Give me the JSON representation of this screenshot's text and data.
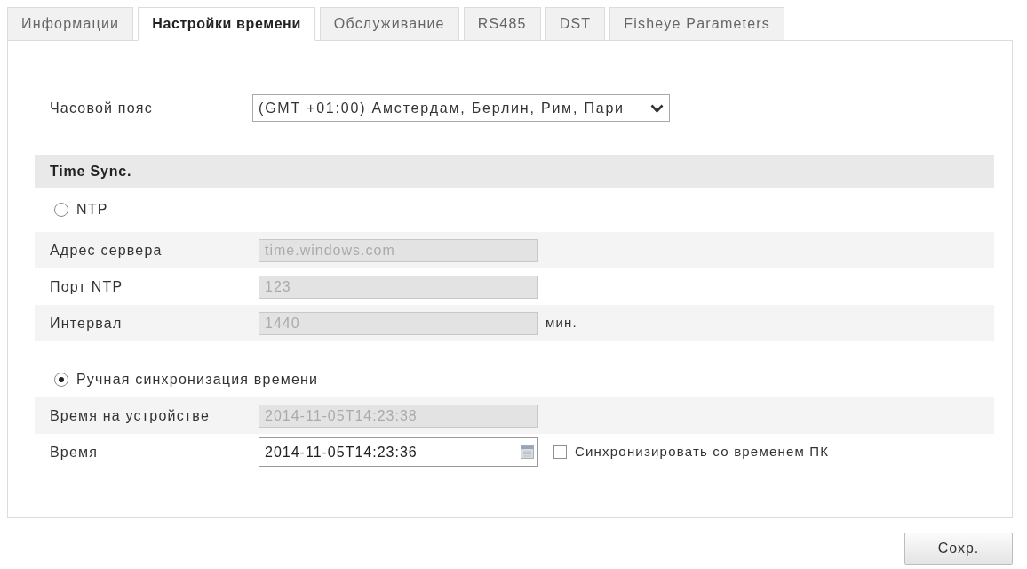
{
  "tabs": [
    {
      "label": "Информации",
      "selected": false
    },
    {
      "label": "Настройки времени",
      "selected": true
    },
    {
      "label": "Обслуживание",
      "selected": false
    },
    {
      "label": "RS485",
      "selected": false
    },
    {
      "label": "DST",
      "selected": false
    },
    {
      "label": "Fisheye Parameters",
      "selected": false
    }
  ],
  "timezone": {
    "label": "Часовой пояс",
    "value": "(GMT +01:00) Амстердам, Берлин, Рим, Пари"
  },
  "time_sync": {
    "title": "Time Sync.",
    "modes": [
      {
        "label": "NTP",
        "selected": false,
        "fields": [
          {
            "kind": "text",
            "label": "Адрес сервера",
            "value": "time.windows.com",
            "disabled": true
          },
          {
            "kind": "text",
            "label": "Порт NTP",
            "value": "123",
            "disabled": true
          },
          {
            "kind": "text",
            "label": "Интервал",
            "value": "1440",
            "disabled": true,
            "unit": "мин."
          }
        ]
      },
      {
        "label": "Ручная синхронизация времени",
        "selected": true,
        "fields": [
          {
            "kind": "text",
            "label": "Время на устройстве",
            "value": "2014-11-05T14:23:38",
            "disabled": true
          },
          {
            "kind": "datetime",
            "label": "Время",
            "value": "2014-11-05T14:23:36",
            "disabled": false,
            "sync_option": {
              "label": "Синхронизировать со временем ПК",
              "checked": false
            }
          }
        ]
      }
    ]
  },
  "save_button": "Сохр."
}
